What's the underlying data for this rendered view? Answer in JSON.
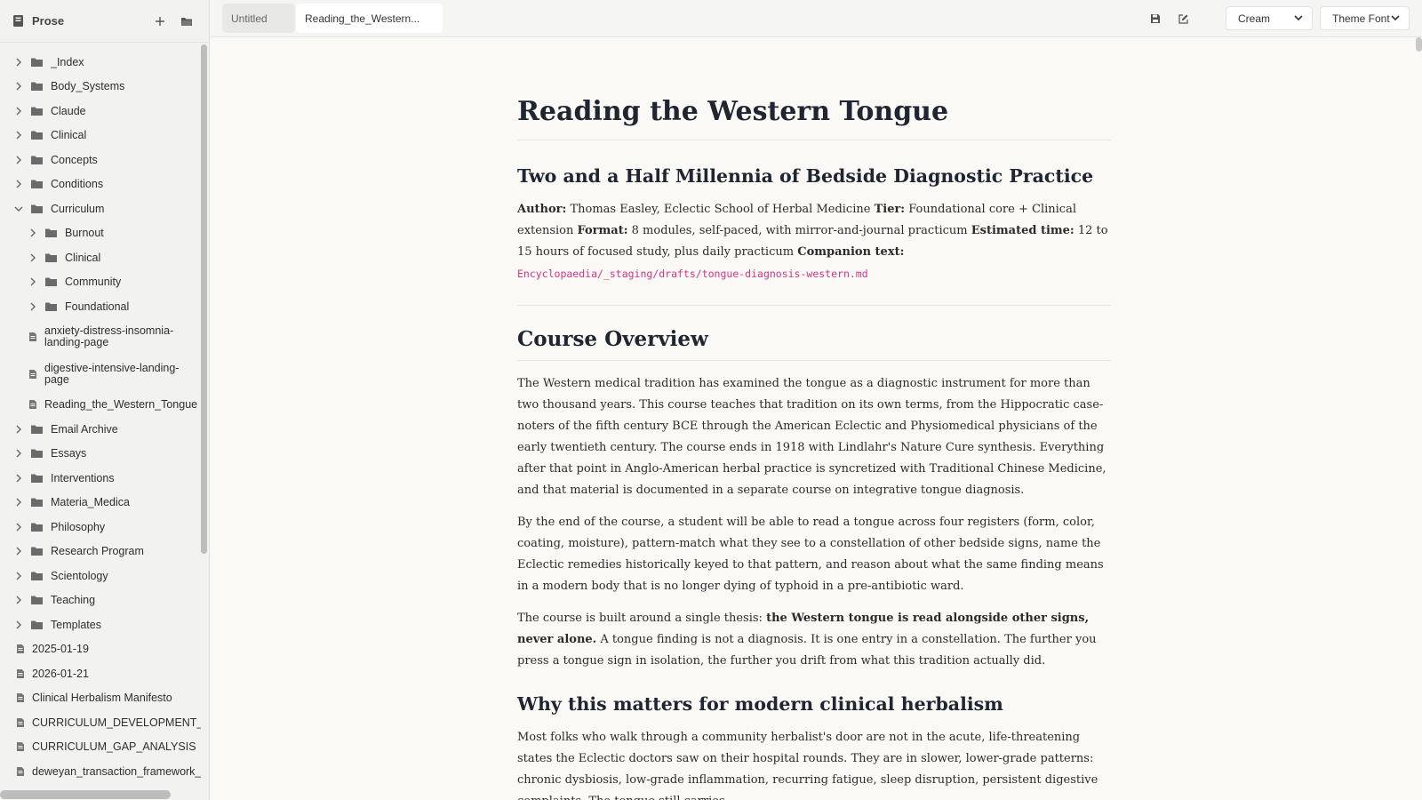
{
  "sidebar": {
    "title": "Prose",
    "tree": [
      {
        "label": "_Index",
        "type": "folder",
        "depth": 0,
        "expanded": false
      },
      {
        "label": "Body_Systems",
        "type": "folder",
        "depth": 0,
        "expanded": false
      },
      {
        "label": "Claude",
        "type": "folder",
        "depth": 0,
        "expanded": false
      },
      {
        "label": "Clinical",
        "type": "folder",
        "depth": 0,
        "expanded": false
      },
      {
        "label": "Concepts",
        "type": "folder",
        "depth": 0,
        "expanded": false
      },
      {
        "label": "Conditions",
        "type": "folder",
        "depth": 0,
        "expanded": false
      },
      {
        "label": "Curriculum",
        "type": "folder",
        "depth": 0,
        "expanded": true
      },
      {
        "label": "Burnout",
        "type": "folder",
        "depth": 1,
        "expanded": false
      },
      {
        "label": "Clinical",
        "type": "folder",
        "depth": 1,
        "expanded": false
      },
      {
        "label": "Community",
        "type": "folder",
        "depth": 1,
        "expanded": false
      },
      {
        "label": "Foundational",
        "type": "folder",
        "depth": 1,
        "expanded": false
      },
      {
        "label": "anxiety-distress-insomnia-landing-page",
        "type": "file",
        "depth": 1,
        "tall": true
      },
      {
        "label": "digestive-intensive-landing-page",
        "type": "file",
        "depth": 1,
        "tall": true
      },
      {
        "label": "Reading_the_Western_Tongue",
        "type": "file",
        "depth": 1
      },
      {
        "label": "Email Archive",
        "type": "folder",
        "depth": 0,
        "expanded": false
      },
      {
        "label": "Essays",
        "type": "folder",
        "depth": 0,
        "expanded": false
      },
      {
        "label": "Interventions",
        "type": "folder",
        "depth": 0,
        "expanded": false
      },
      {
        "label": "Materia_Medica",
        "type": "folder",
        "depth": 0,
        "expanded": false
      },
      {
        "label": "Philosophy",
        "type": "folder",
        "depth": 0,
        "expanded": false
      },
      {
        "label": "Research Program",
        "type": "folder",
        "depth": 0,
        "expanded": false
      },
      {
        "label": "Scientology",
        "type": "folder",
        "depth": 0,
        "expanded": false
      },
      {
        "label": "Teaching",
        "type": "folder",
        "depth": 0,
        "expanded": false
      },
      {
        "label": "Templates",
        "type": "folder",
        "depth": 0,
        "expanded": false
      },
      {
        "label": "2025-01-19",
        "type": "file",
        "depth": 0
      },
      {
        "label": "2026-01-21",
        "type": "file",
        "depth": 0
      },
      {
        "label": "Clinical Herbalism Manifesto",
        "type": "file",
        "depth": 0
      },
      {
        "label": "CURRICULUM_DEVELOPMENT_PLA",
        "type": "file",
        "depth": 0
      },
      {
        "label": "CURRICULUM_GAP_ANALYSIS",
        "type": "file",
        "depth": 0
      },
      {
        "label": "deweyan_transaction_framework_su",
        "type": "file",
        "depth": 0
      }
    ]
  },
  "tabs": [
    {
      "label": "Untitled",
      "active": false
    },
    {
      "label": "Reading_the_Western...",
      "active": true
    }
  ],
  "toolbar": {
    "save_icon": "save-icon",
    "edit_icon": "edit-icon",
    "theme_value": "Cream",
    "font_value": "Theme Font"
  },
  "document": {
    "title": "Reading the Western Tongue",
    "subtitle": "Two and a Half Millennia of Bedside Diagnostic Practice",
    "meta": {
      "author_label": "Author:",
      "author_value": "Thomas Easley, Eclectic School of Herbal Medicine",
      "tier_label": "Tier:",
      "tier_value": "Foundational core + Clinical extension",
      "format_label": "Format:",
      "format_value": "8 modules, self-paced, with mirror-and-journal practicum",
      "time_label": "Estimated time:",
      "time_value": "12 to 15 hours of focused study, plus daily practicum",
      "companion_label": "Companion text:",
      "companion_value": "Encyclopaedia/_staging/drafts/tongue-diagnosis-western.md"
    },
    "overview_heading": "Course Overview",
    "p1": "The Western medical tradition has examined the tongue as a diagnostic instrument for more than two thousand years. This course teaches that tradition on its own terms, from the Hippocratic case-noters of the fifth century BCE through the American Eclectic and Physiomedical physicians of the early twentieth century. The course ends in 1918 with Lindlahr's Nature Cure synthesis. Everything after that point in Anglo-American herbal practice is syncretized with Traditional Chinese Medicine, and that material is documented in a separate course on integrative tongue diagnosis.",
    "p2": "By the end of the course, a student will be able to read a tongue across four registers (form, color, coating, moisture), pattern-match what they see to a constellation of other bedside signs, name the Eclectic remedies historically keyed to that pattern, and reason about what the same finding means in a modern body that is no longer dying of typhoid in a pre-antibiotic ward.",
    "p3_start": "The course is built around a single thesis: ",
    "p3_bold": "the Western tongue is read alongside other signs, never alone.",
    "p3_end": " A tongue finding is not a diagnosis. It is one entry in a constellation. The further you press a tongue sign in isolation, the further you drift from what this tradition actually did.",
    "why_heading": "Why this matters for modern clinical herbalism",
    "p4": "Most folks who walk through a community herbalist's door are not in the acute, life-threatening states the Eclectic doctors saw on their hospital rounds. They are in slower, lower-grade patterns: chronic dysbiosis, low-grade inflammation, recurring fatigue, sleep disruption, persistent digestive complaints. The tongue still carries"
  }
}
